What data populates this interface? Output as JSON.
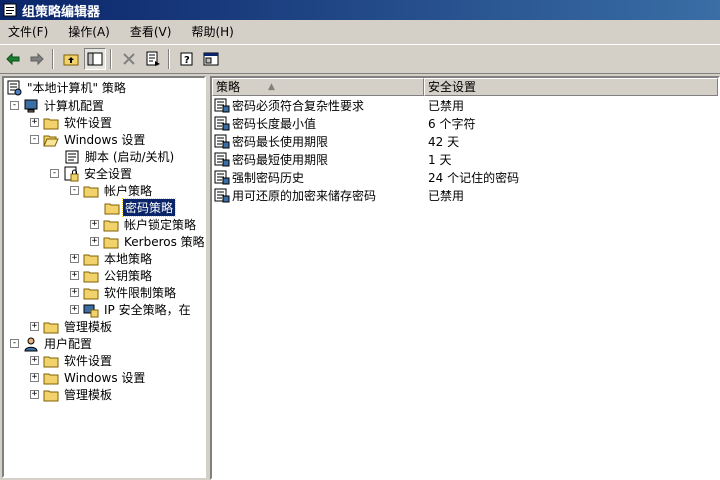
{
  "window": {
    "title": "组策略编辑器"
  },
  "menu": [
    {
      "label": "文件(F)"
    },
    {
      "label": "操作(A)"
    },
    {
      "label": "查看(V)"
    },
    {
      "label": "帮助(H)"
    }
  ],
  "toolbar": {
    "buttons": [
      "back-icon",
      "forward-icon",
      "up-folder-icon",
      "show-hide-tree-icon",
      "delete-icon",
      "export-list-icon",
      "help-icon",
      "properties-icon"
    ]
  },
  "tree": [
    {
      "label": "\"本地计算机\" 策略",
      "icon": "policy-root-icon",
      "expander": "-"
    },
    {
      "label": "计算机配置",
      "icon": "computer-icon",
      "expander": "-"
    },
    {
      "label": "软件设置",
      "icon": "folder-icon",
      "expander": "+"
    },
    {
      "label": "Windows 设置",
      "icon": "folder-icon",
      "expander": "-"
    },
    {
      "label": "脚本 (启动/关机)",
      "icon": "script-icon",
      "expander": ""
    },
    {
      "label": "安全设置",
      "icon": "security-icon",
      "expander": "-"
    },
    {
      "label": "帐户策略",
      "icon": "folder-icon",
      "expander": "-"
    },
    {
      "label": "密码策略",
      "icon": "folder-icon",
      "expander": "",
      "selected": true
    },
    {
      "label": "帐户锁定策略",
      "icon": "folder-icon",
      "expander": "+"
    },
    {
      "label": "Kerberos 策略",
      "icon": "folder-icon",
      "expander": "+"
    },
    {
      "label": "本地策略",
      "icon": "folder-icon",
      "expander": "+"
    },
    {
      "label": "公钥策略",
      "icon": "folder-icon",
      "expander": "+"
    },
    {
      "label": "软件限制策略",
      "icon": "folder-icon",
      "expander": "+"
    },
    {
      "label": "IP 安全策略，在",
      "icon": "ip-security-icon",
      "expander": "+"
    },
    {
      "label": "管理模板",
      "icon": "folder-icon",
      "expander": "+"
    },
    {
      "label": "用户配置",
      "icon": "user-icon",
      "expander": "-"
    },
    {
      "label": "软件设置",
      "icon": "folder-icon",
      "expander": "+"
    },
    {
      "label": "Windows 设置",
      "icon": "folder-icon",
      "expander": "+"
    },
    {
      "label": "管理模板",
      "icon": "folder-icon",
      "expander": "+"
    }
  ],
  "list": {
    "columns": [
      "策略",
      "安全设置"
    ],
    "rows": [
      {
        "policy": "密码必须符合复杂性要求",
        "setting": "已禁用"
      },
      {
        "policy": "密码长度最小值",
        "setting": "6 个字符"
      },
      {
        "policy": "密码最长使用期限",
        "setting": "42 天"
      },
      {
        "policy": "密码最短使用期限",
        "setting": "1 天"
      },
      {
        "policy": "强制密码历史",
        "setting": "24 个记住的密码"
      },
      {
        "policy": "用可还原的加密来储存密码",
        "setting": "已禁用"
      }
    ]
  }
}
